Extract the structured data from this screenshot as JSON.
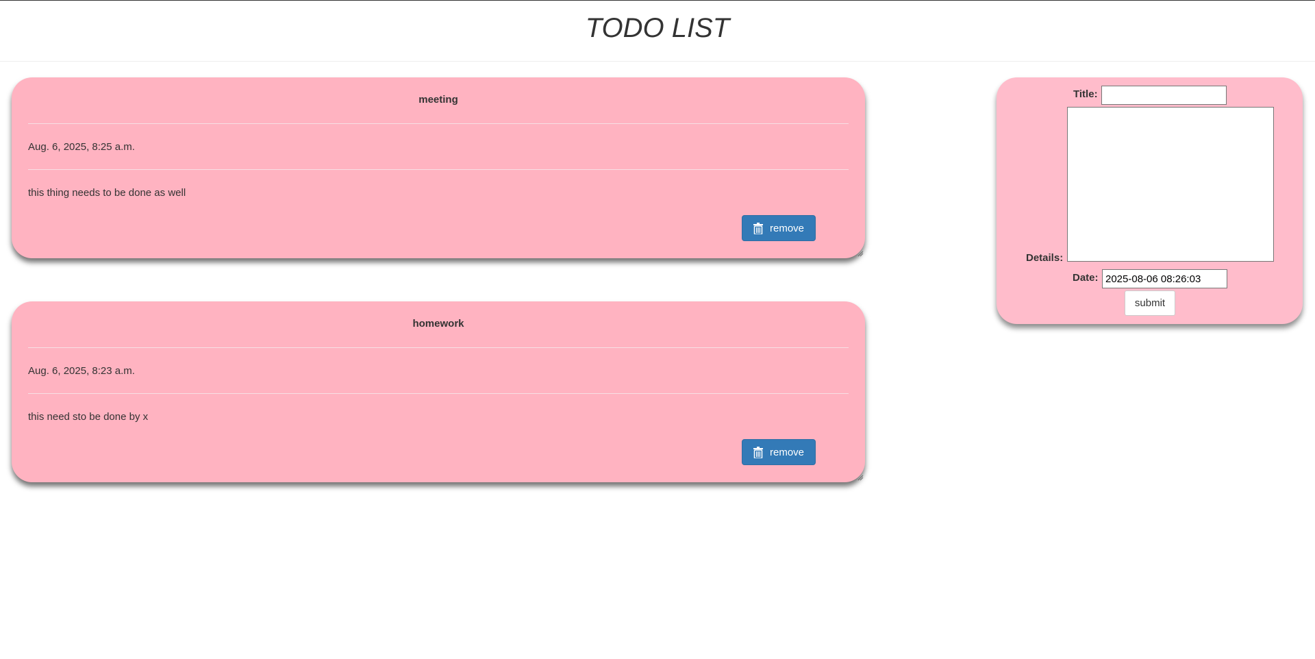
{
  "header": {
    "title": "TODO LIST"
  },
  "todos": [
    {
      "title": "meeting",
      "date": "Aug. 6, 2025, 8:25 a.m.",
      "details": "this thing needs to be done as well",
      "remove_label": "remove"
    },
    {
      "title": "homework",
      "date": "Aug. 6, 2025, 8:23 a.m.",
      "details": "this need sto be done by x",
      "remove_label": "remove"
    }
  ],
  "form": {
    "title_label": "Title:",
    "title_value": "",
    "details_label": "Details:",
    "details_value": "",
    "date_label": "Date:",
    "date_value": "2025-08-06 08:26:03",
    "submit_label": "submit"
  },
  "icons": {
    "remove": "trash-icon"
  },
  "colors": {
    "card_bg": "#ffb3c1",
    "form_bg": "#ffbccb",
    "button_primary": "#337ab7"
  }
}
